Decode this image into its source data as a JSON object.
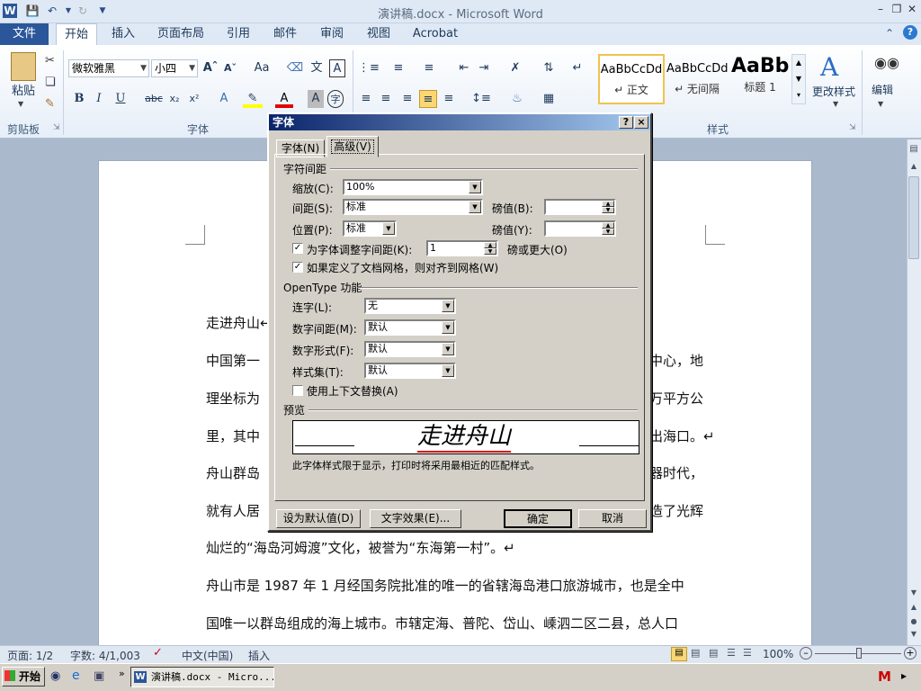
{
  "window": {
    "title": "演讲稿.docx - Microsoft Word"
  },
  "ribbon": {
    "file_tab": "文件",
    "tabs": [
      "开始",
      "插入",
      "页面布局",
      "引用",
      "邮件",
      "审阅",
      "视图",
      "Acrobat"
    ],
    "active_tab": "开始",
    "paste_label": "粘贴",
    "font_name": "微软雅黑",
    "font_size": "小四",
    "styles": [
      {
        "preview": "AaBbCcDd",
        "name": "↵ 正文"
      },
      {
        "preview": "AaBbCcDd",
        "name": "↵ 无间隔"
      },
      {
        "preview": "AaBb",
        "name": "标题 1"
      }
    ],
    "change_styles": "更改样式",
    "edit_label": "编辑",
    "groups": {
      "clipboard": "剪贴板",
      "font": "字体",
      "styles": "样式"
    }
  },
  "document": {
    "lines": [
      {
        "text": "走进舟山↵"
      },
      {
        "left": "中国第一",
        "right": "中心，地"
      },
      {
        "left": "理坐标为",
        "right": "万平方公"
      },
      {
        "left": "里，其中",
        "right": "出海口。↵"
      },
      {
        "left": "舟山群岛",
        "right": "器时代，"
      },
      {
        "left": "就有人居",
        "right": "造了光辉"
      },
      {
        "text": "灿烂的“海岛河姆渡”文化，被誉为“东海第一村”。↵"
      },
      {
        "text": "舟山市是 1987 年 1 月经国务院批准的唯一的省辖海岛港口旅游城市，也是全中"
      },
      {
        "text": "国唯一以群岛组成的海上城市。市辖定海、普陀、岱山、嵊泗二区二县，总人口"
      }
    ]
  },
  "dialog": {
    "title": "字体",
    "help": "?",
    "close": "×",
    "tabs": [
      "字体(N)",
      "高级(V)"
    ],
    "section_spacing": "字符间距",
    "scale_label": "缩放(C):",
    "scale_value": "100%",
    "spacing_label": "间距(S):",
    "spacing_value": "标准",
    "spacing_pts_label": "磅值(B):",
    "spacing_pts_value": "",
    "position_label": "位置(P):",
    "position_value": "标准",
    "position_pts_label": "磅值(Y):",
    "position_pts_value": "",
    "kerning_label": "为字体调整字间距(K):",
    "kerning_checked": true,
    "kerning_value": "1",
    "kerning_suffix": "磅或更大(O)",
    "grid_label": "如果定义了文档网格，则对齐到网格(W)",
    "grid_checked": true,
    "section_opentype": "OpenType 功能",
    "ligature_label": "连字(L):",
    "ligature_value": "无",
    "num_spacing_label": "数字间距(M):",
    "num_spacing_value": "默认",
    "num_form_label": "数字形式(F):",
    "num_form_value": "默认",
    "stylistic_label": "样式集(T):",
    "stylistic_value": "默认",
    "contextual_label": "使用上下文替换(A)",
    "contextual_checked": false,
    "section_preview": "预览",
    "preview_text": "走进舟山",
    "preview_note": "此字体样式限于显示，打印时将采用最相近的匹配样式。",
    "btn_default": "设为默认值(D)",
    "btn_effects": "文字效果(E)...",
    "btn_ok": "确定",
    "btn_cancel": "取消"
  },
  "statusbar": {
    "page": "页面: 1/2",
    "words": "字数: 4/1,003",
    "language": "中文(中国)",
    "mode": "插入",
    "zoom": "100%"
  },
  "taskbar": {
    "start": "开始",
    "task": "演讲稿.docx - Micro..."
  },
  "colors": {
    "file_tab": "#2b579a",
    "dialog_title_start": "#0a246a",
    "dialog_face": "#d4d0c8"
  }
}
